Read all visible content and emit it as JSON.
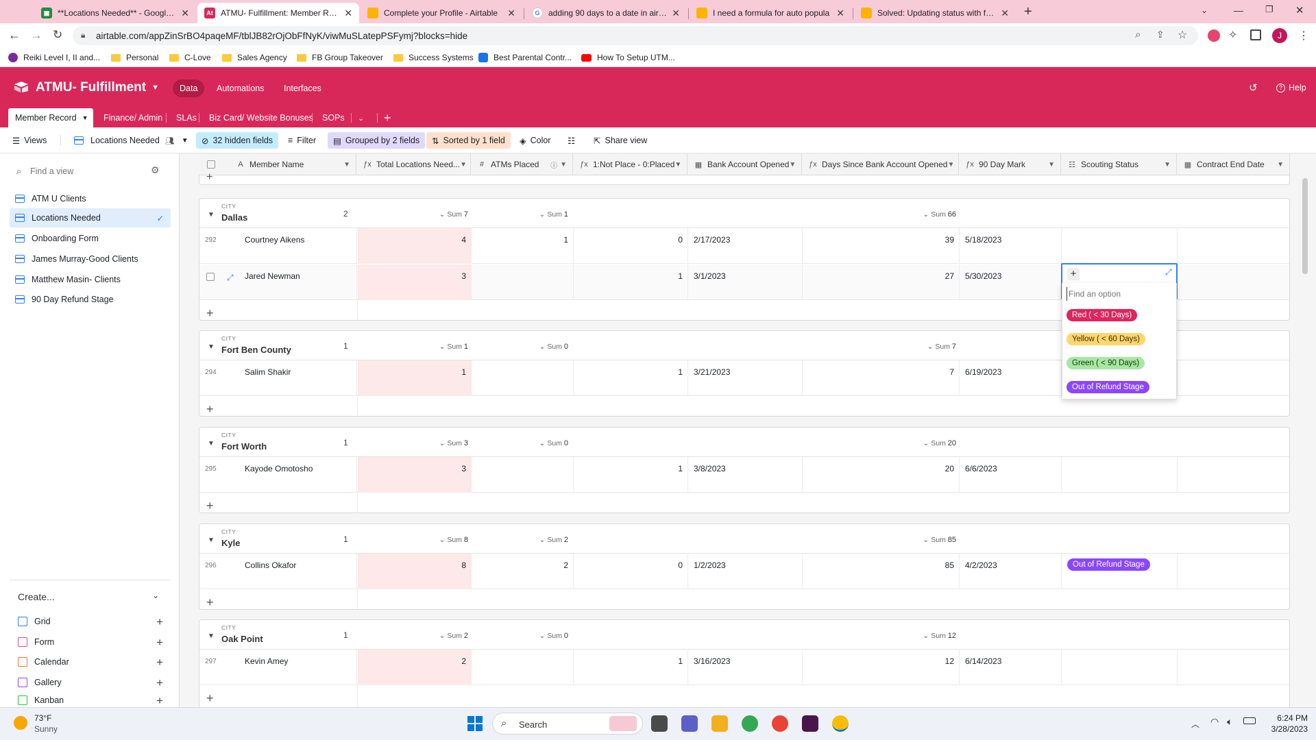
{
  "browser": {
    "tabs": [
      {
        "title": "**Locations Needed** - Google S",
        "icon": "google-sheets-icon",
        "color": "#1e8e3e"
      },
      {
        "title": "ATMU- Fulfillment: Member Reco",
        "icon": "airtable-icon",
        "color": "#d8285a"
      },
      {
        "title": "Complete your Profile - Airtable",
        "icon": "airtable-icon",
        "color": "#fcb400"
      },
      {
        "title": "adding 90 days to a date in airtab",
        "icon": "google-icon",
        "color": "#4285f4"
      },
      {
        "title": "I need a formula for auto popula",
        "icon": "airtable-icon",
        "color": "#fcb400"
      },
      {
        "title": "Solved: Updating status with form",
        "icon": "airtable-icon",
        "color": "#fcb400"
      }
    ],
    "url": "airtable.com/appZinSrBO4paqeMF/tblJB82rOjObFfNyK/viwMuSLatepPSFymj?blocks=hide",
    "bookmarks": [
      "Reiki Level I, II and...",
      "Personal",
      "C-Love",
      "Sales Agency",
      "FB Group Takeover",
      "Success Systems",
      "Best Parental Contr...",
      "How To Setup UTM..."
    ],
    "profile_initial": "J"
  },
  "app": {
    "base_name": "ATMU- Fulfillment",
    "nav": [
      "Data",
      "Automations",
      "Interfaces"
    ],
    "help": "Help",
    "tables": [
      "Member Record",
      "Finance/ Admin",
      "SLAs",
      "Biz Card/ Website Bonuses",
      "SOPs"
    ]
  },
  "viewbar": {
    "views": "Views",
    "current_view": "Locations Needed",
    "hidden_fields": "32 hidden fields",
    "filter": "Filter",
    "grouped": "Grouped by 2 fields",
    "sorted": "Sorted by 1 field",
    "color": "Color",
    "share": "Share view"
  },
  "sidebar": {
    "find_placeholder": "Find a view",
    "views": [
      "ATM U Clients",
      "Locations Needed",
      "Onboarding Form",
      "James Murray-Good Clients",
      "Matthew Masin- Clients",
      "90 Day Refund Stage"
    ],
    "create_label": "Create...",
    "create_items": [
      "Grid",
      "Form",
      "Calendar",
      "Gallery",
      "Kanban"
    ]
  },
  "grid": {
    "columns": [
      "Member Name",
      "Total Locations Need...",
      "ATMs Placed",
      "1:Not Place - 0:Placed",
      "Bank Account Opened",
      "Days Since Bank Account Opened",
      "90 Day Mark",
      "Scouting Status",
      "Contract End Date"
    ],
    "group_label": "CITY",
    "sum_label": "Sum",
    "groups": [
      {
        "name": "Dallas",
        "count": "2",
        "sum_total": "7",
        "sum_placed": "1",
        "sum_days": "66",
        "rows": [
          {
            "id": "292",
            "name": "Courtney Aikens",
            "total": "4",
            "placed": "1",
            "notplaced": "0",
            "opened": "2/17/2023",
            "days": "39",
            "mark": "5/18/2023",
            "status": ""
          },
          {
            "id": "",
            "name": "Jared Newman",
            "total": "3",
            "placed": "",
            "notplaced": "1",
            "opened": "3/1/2023",
            "days": "27",
            "mark": "5/30/2023",
            "status": ""
          }
        ]
      },
      {
        "name": "Fort Ben County",
        "count": "1",
        "sum_total": "1",
        "sum_placed": "0",
        "sum_days": "7",
        "rows": [
          {
            "id": "294",
            "name": "Salim Shakir",
            "total": "1",
            "placed": "",
            "notplaced": "1",
            "opened": "3/21/2023",
            "days": "7",
            "mark": "6/19/2023",
            "status": ""
          }
        ]
      },
      {
        "name": "Fort Worth",
        "count": "1",
        "sum_total": "3",
        "sum_placed": "0",
        "sum_days": "20",
        "rows": [
          {
            "id": "295",
            "name": "Kayode Omotosho",
            "total": "3",
            "placed": "",
            "notplaced": "1",
            "opened": "3/8/2023",
            "days": "20",
            "mark": "6/6/2023",
            "status": ""
          }
        ]
      },
      {
        "name": "Kyle",
        "count": "1",
        "sum_total": "8",
        "sum_placed": "2",
        "sum_days": "85",
        "rows": [
          {
            "id": "296",
            "name": "Collins Okafor",
            "total": "8",
            "placed": "2",
            "notplaced": "0",
            "opened": "1/2/2023",
            "days": "85",
            "mark": "4/2/2023",
            "status": "Out of Refund Stage"
          }
        ]
      },
      {
        "name": "Oak Point",
        "count": "1",
        "sum_total": "2",
        "sum_placed": "0",
        "sum_days": "12",
        "rows": [
          {
            "id": "297",
            "name": "Kevin Amey",
            "total": "2",
            "placed": "",
            "notplaced": "1",
            "opened": "3/16/2023",
            "days": "12",
            "mark": "6/14/2023",
            "status": ""
          }
        ]
      }
    ]
  },
  "dropdown": {
    "placeholder": "Find an option",
    "options": [
      {
        "label": "Red ( < 30 Days)",
        "bg": "#e0245e",
        "fg": "#ffffff"
      },
      {
        "label": "Yellow ( < 60 Days)",
        "bg": "#ffd66e",
        "fg": "#3b2e00"
      },
      {
        "label": "Green ( < 90 Days)",
        "bg": "#a8e6a3",
        "fg": "#0b3d0b"
      },
      {
        "label": "Out of Refund Stage",
        "bg": "#8b46ff",
        "fg": "#ffffff"
      }
    ]
  },
  "taskbar": {
    "weather_temp": "73°F",
    "weather_desc": "Sunny",
    "search": "Search",
    "time": "6:24 PM",
    "date": "3/28/2023"
  },
  "colors": {
    "brand": "#d8285a",
    "selection": "#2d7ff9"
  }
}
